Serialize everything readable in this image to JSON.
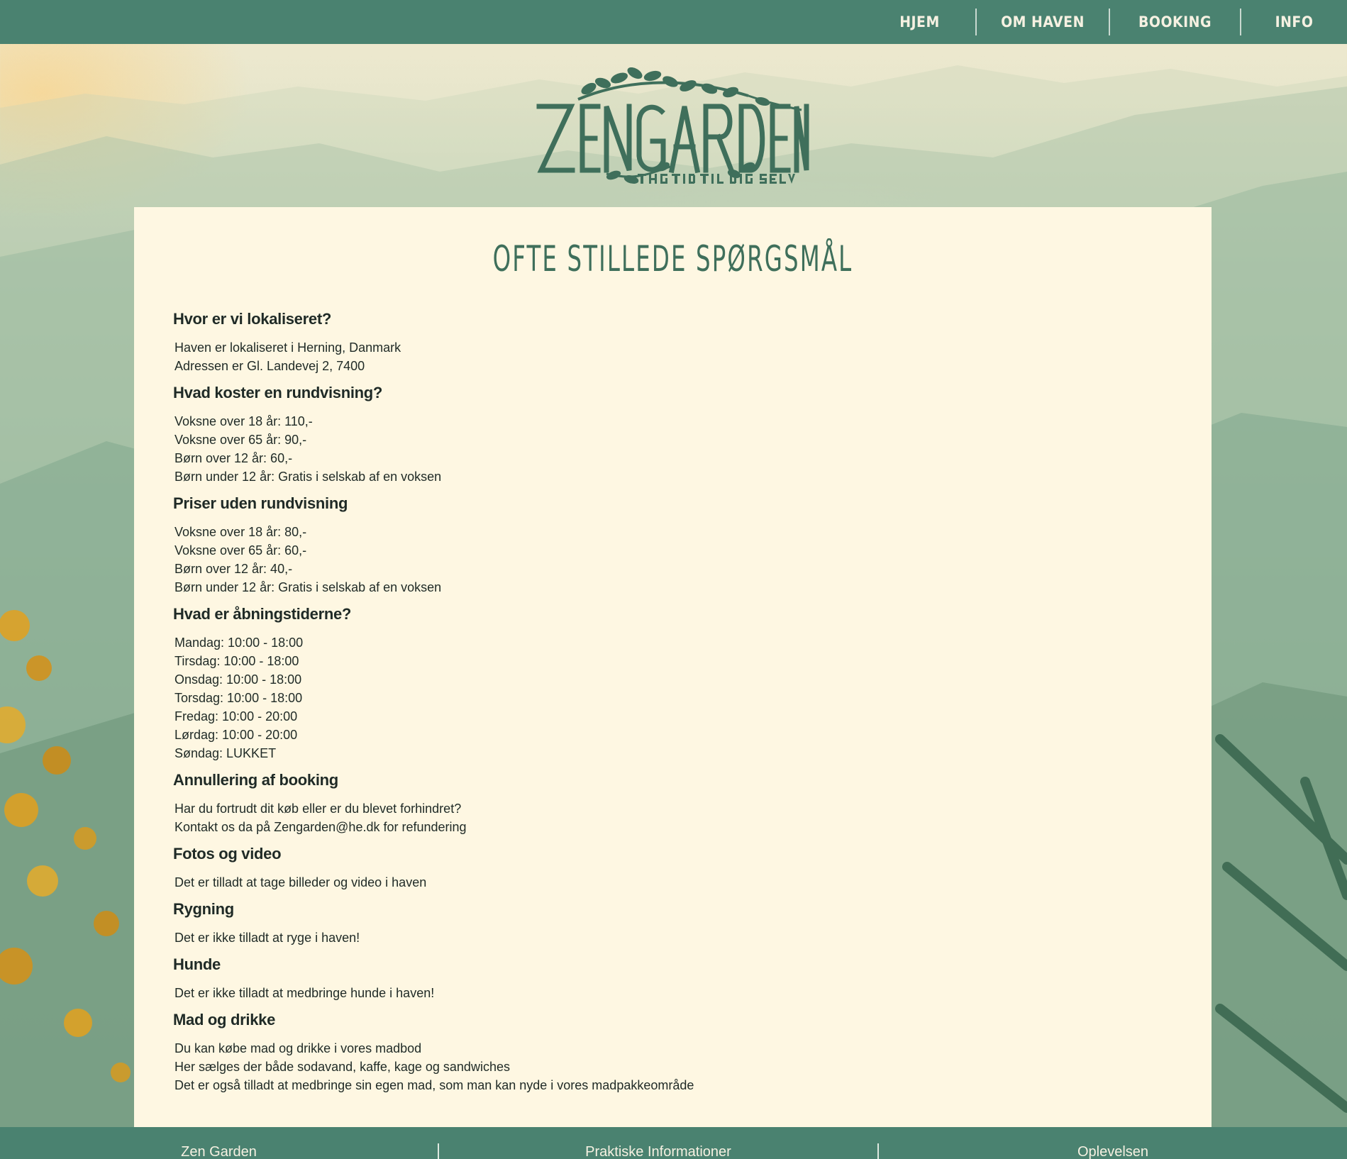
{
  "nav": {
    "items": [
      {
        "label": "HJEM"
      },
      {
        "label": "OM HAVEN"
      },
      {
        "label": "BOOKING"
      },
      {
        "label": "INFO"
      }
    ]
  },
  "logo": {
    "name": "ZENGARDEN",
    "tagline": "TAG TID TIL DIG SELV"
  },
  "page": {
    "title": "OFTE STILLEDE SPØRGSMÅL"
  },
  "faq": [
    {
      "question": "Hvor er vi lokaliseret?",
      "lines": [
        "Haven er lokaliseret i Herning, Danmark",
        "Adressen er Gl. Landevej 2, 7400"
      ]
    },
    {
      "question": "Hvad koster en rundvisning?",
      "lines": [
        "Voksne over 18 år: 110,-",
        "Voksne over 65 år: 90,-",
        "Børn over 12 år: 60,-",
        "Børn under 12 år: Gratis i selskab af en voksen"
      ]
    },
    {
      "question": "Priser uden rundvisning",
      "lines": [
        "Voksne over 18 år: 80,-",
        "Voksne over 65 år: 60,-",
        "Børn over 12 år: 40,-",
        "Børn under 12 år: Gratis i selskab af en voksen"
      ]
    },
    {
      "question": "Hvad er åbningstiderne?",
      "lines": [
        "Mandag: 10:00 - 18:00",
        "Tirsdag: 10:00 - 18:00",
        "Onsdag: 10:00 - 18:00",
        "Torsdag: 10:00 - 18:00",
        "Fredag: 10:00 - 20:00",
        "Lørdag: 10:00 - 20:00",
        "Søndag: LUKKET"
      ]
    },
    {
      "question": "Annullering af booking",
      "lines": [
        "Har du fortrudt dit køb eller er du blevet forhindret?",
        "Kontakt os da på Zengarden@he.dk for refundering"
      ]
    },
    {
      "question": "Fotos og video",
      "lines": [
        "Det er tilladt at tage billeder og video i haven"
      ]
    },
    {
      "question": "Rygning",
      "lines": [
        "Det er ikke tilladt at ryge i haven!"
      ]
    },
    {
      "question": "Hunde",
      "lines": [
        "Det er ikke tilladt at medbringe hunde i haven!"
      ]
    },
    {
      "question": "Mad og drikke",
      "lines": [
        "Du kan købe mad og drikke i vores madbod",
        "Her sælges der både sodavand, kaffe, kage og sandwiches",
        "Det er også tilladt at medbringe sin egen mad, som man kan nyde i vores madpakkeområde"
      ]
    }
  ],
  "footer": {
    "columns": [
      {
        "label": "Zen Garden"
      },
      {
        "label": "Praktiske Informationer"
      },
      {
        "label": "Oplevelsen"
      }
    ]
  },
  "colors": {
    "nav_bg": "#4a8270",
    "panel_bg": "#fef7e2",
    "title_green": "#3f6f5b",
    "text": "#1f2a26"
  }
}
